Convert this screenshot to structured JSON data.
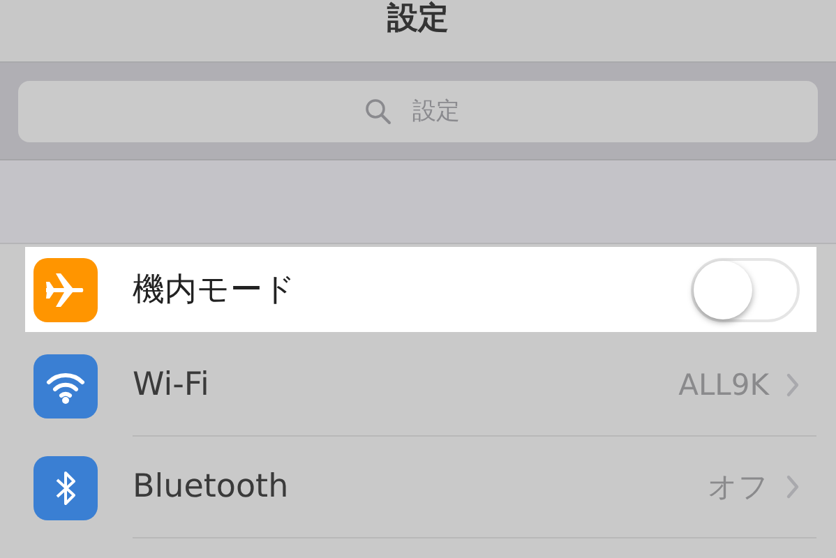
{
  "nav": {
    "title": "設定"
  },
  "search": {
    "placeholder": "設定"
  },
  "rows": [
    {
      "kind": "toggle",
      "label": "機内モード",
      "on": false,
      "highlighted": true,
      "color": "#ff9500"
    },
    {
      "kind": "link",
      "label": "Wi-Fi",
      "value": "ALL9K",
      "highlighted": false,
      "color": "#3a7fd3"
    },
    {
      "kind": "link",
      "label": "Bluetooth",
      "value": "オフ",
      "highlighted": false,
      "color": "#3a7fd3"
    }
  ]
}
